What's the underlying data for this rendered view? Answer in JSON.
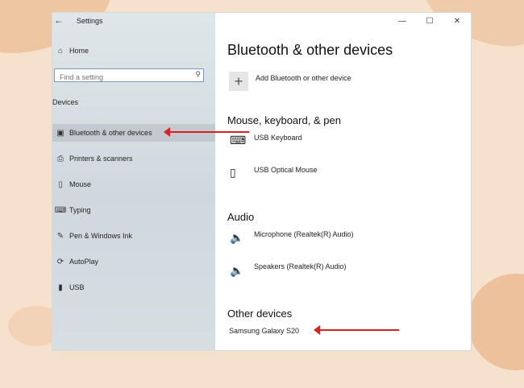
{
  "window": {
    "title": "Settings",
    "controls": [
      "minimize",
      "maximize",
      "close"
    ]
  },
  "sidebar": {
    "home_label": "Home",
    "search_placeholder": "Find a setting",
    "section_label": "Devices",
    "items": [
      {
        "label": "Bluetooth & other devices",
        "icon": "bluetooth-devices-icon",
        "active": true
      },
      {
        "label": "Printers & scanners",
        "icon": "printer-icon"
      },
      {
        "label": "Mouse",
        "icon": "mouse-icon"
      },
      {
        "label": "Typing",
        "icon": "keyboard-icon"
      },
      {
        "label": "Pen & Windows Ink",
        "icon": "pen-icon"
      },
      {
        "label": "AutoPlay",
        "icon": "autoplay-icon"
      },
      {
        "label": "USB",
        "icon": "usb-icon"
      }
    ]
  },
  "main": {
    "title": "Bluetooth & other devices",
    "add_device_label": "Add Bluetooth or other device",
    "groups": [
      {
        "title": "Mouse, keyboard, & pen",
        "devices": [
          "USB Keyboard",
          "USB Optical Mouse"
        ]
      },
      {
        "title": "Audio",
        "devices": [
          "Microphone (Realtek(R) Audio)",
          "Speakers (Realtek(R) Audio)"
        ]
      },
      {
        "title": "Other devices",
        "devices": [
          "Samsung Galaxy S20"
        ]
      }
    ]
  },
  "colors": {
    "accent": "#0078d7",
    "annotation_arrow": "#d8221f",
    "background": "#f6e1cd"
  }
}
